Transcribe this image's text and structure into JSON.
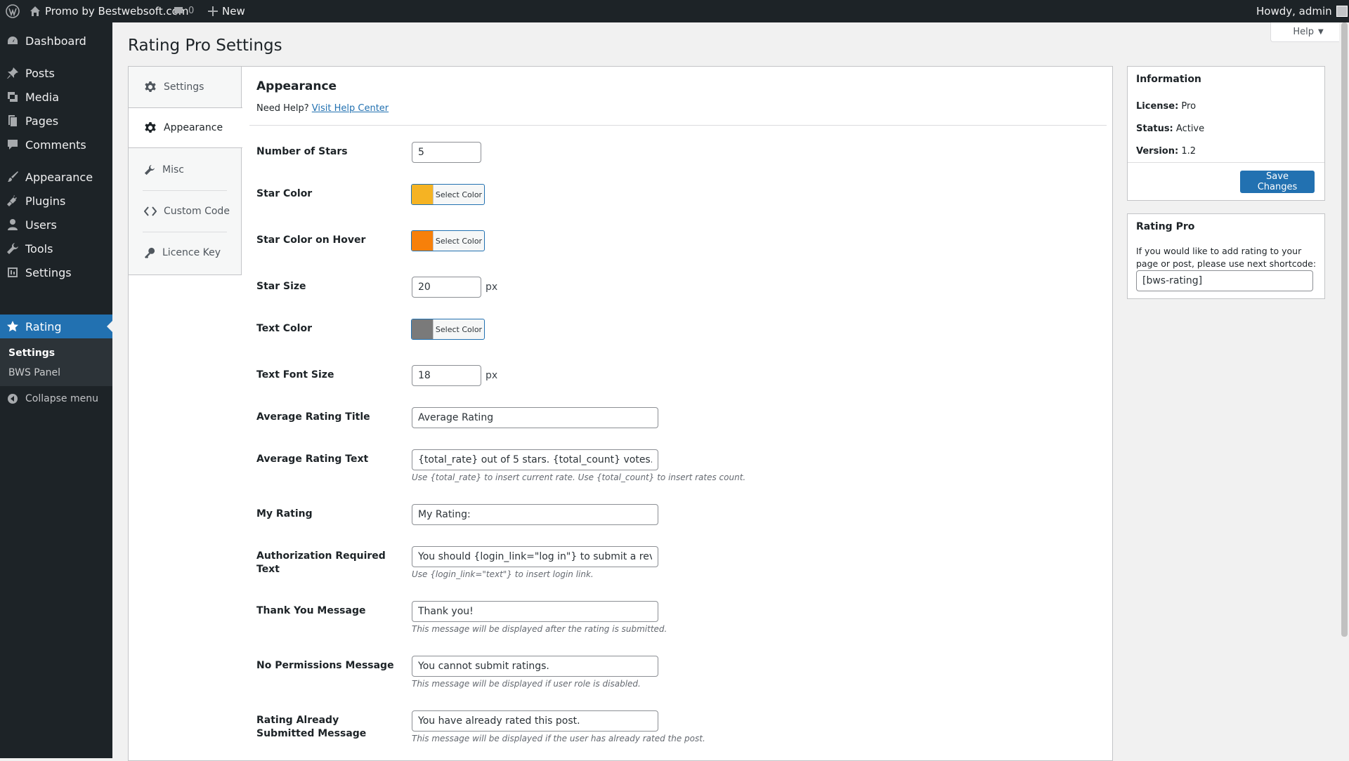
{
  "adminbar": {
    "site_name": "Promo by Bestwebsoft.com",
    "comments_count": "0",
    "new_label": "New",
    "howdy": "Howdy, admin"
  },
  "menu": {
    "items": [
      {
        "label": "Dashboard",
        "icon": "dashboard-icon"
      },
      {
        "label": "Posts",
        "icon": "pin-icon"
      },
      {
        "label": "Media",
        "icon": "media-icon"
      },
      {
        "label": "Pages",
        "icon": "pages-icon"
      },
      {
        "label": "Comments",
        "icon": "comment-icon"
      },
      {
        "label": "Appearance",
        "icon": "brush-icon"
      },
      {
        "label": "Plugins",
        "icon": "plug-icon"
      },
      {
        "label": "Users",
        "icon": "user-icon"
      },
      {
        "label": "Tools",
        "icon": "wrench-icon"
      },
      {
        "label": "Settings",
        "icon": "settings-icon"
      },
      {
        "label": "Rating",
        "icon": "star-icon"
      }
    ],
    "submenu": [
      "Settings",
      "BWS Panel"
    ],
    "collapse": "Collapse menu"
  },
  "page": {
    "title": "Rating Pro Settings",
    "help": "Help"
  },
  "tabs": [
    "Settings",
    "Appearance",
    "Misc",
    "Custom Code",
    "Licence Key"
  ],
  "panel": {
    "heading": "Appearance",
    "need_help": "Need Help?",
    "help_link": "Visit Help Center"
  },
  "fields": {
    "num_stars": {
      "label": "Number of Stars",
      "value": "5"
    },
    "star_color": {
      "label": "Star Color",
      "button": "Select Color",
      "color": "#f5b323"
    },
    "star_hover": {
      "label": "Star Color on Hover",
      "button": "Select Color",
      "color": "#f7800a"
    },
    "star_size": {
      "label": "Star Size",
      "value": "20",
      "unit": "px"
    },
    "text_color": {
      "label": "Text Color",
      "button": "Select Color",
      "color": "#7a7a7a"
    },
    "font_size": {
      "label": "Text Font Size",
      "value": "18",
      "unit": "px"
    },
    "avg_title": {
      "label": "Average Rating Title",
      "value": "Average Rating"
    },
    "avg_text": {
      "label": "Average Rating Text",
      "value": "{total_rate} out of 5 stars. {total_count} votes.",
      "desc": "Use {total_rate} to insert current rate. Use {total_count} to insert rates count."
    },
    "my_rating": {
      "label": "My Rating",
      "value": "My Rating:"
    },
    "auth_text": {
      "label": "Authorization Required Text",
      "value": "You should {login_link=\"log in\"} to submit a review.",
      "desc": "Use {login_link=\"text\"} to insert login link."
    },
    "thank_you": {
      "label": "Thank You Message",
      "value": "Thank you!",
      "desc": "This message will be displayed after the rating is submitted."
    },
    "no_perm": {
      "label": "No Permissions Message",
      "value": "You cannot submit ratings.",
      "desc": "This message will be displayed if user role is disabled."
    },
    "already": {
      "label": "Rating Already Submitted Message",
      "value": "You have already rated this post.",
      "desc": "This message will be displayed if the user has already rated the post."
    }
  },
  "info": {
    "title": "Information",
    "license_label": "License:",
    "license": "Pro",
    "status_label": "Status:",
    "status": "Active",
    "version_label": "Version:",
    "version": "1.2",
    "save": "Save Changes"
  },
  "rating_pro": {
    "title": "Rating Pro",
    "text": "If you would like to add rating to your page or post, please use next shortcode:",
    "shortcode": "[bws-rating]"
  }
}
